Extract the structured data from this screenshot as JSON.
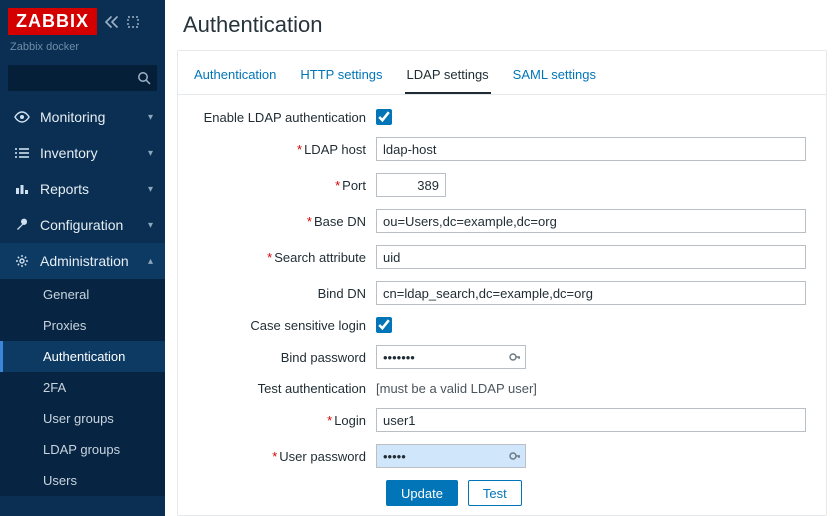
{
  "brand": {
    "logo": "ZABBIX",
    "server_name": "Zabbix docker"
  },
  "search": {
    "placeholder": ""
  },
  "nav": {
    "items": [
      {
        "label": "Monitoring"
      },
      {
        "label": "Inventory"
      },
      {
        "label": "Reports"
      },
      {
        "label": "Configuration"
      },
      {
        "label": "Administration"
      }
    ],
    "admin_sub": [
      {
        "label": "General"
      },
      {
        "label": "Proxies"
      },
      {
        "label": "Authentication"
      },
      {
        "label": "2FA"
      },
      {
        "label": "User groups"
      },
      {
        "label": "LDAP groups"
      },
      {
        "label": "Users"
      }
    ]
  },
  "page": {
    "title": "Authentication"
  },
  "tabs": {
    "items": [
      {
        "label": "Authentication"
      },
      {
        "label": "HTTP settings"
      },
      {
        "label": "LDAP settings"
      },
      {
        "label": "SAML settings"
      }
    ]
  },
  "form": {
    "labels": {
      "enable": "Enable LDAP authentication",
      "host": "LDAP host",
      "port": "Port",
      "basedn": "Base DN",
      "searchattr": "Search attribute",
      "binddn": "Bind DN",
      "casesens": "Case sensitive login",
      "bindpw": "Bind password",
      "testauth": "Test authentication",
      "testauth_hint": "[must be a valid LDAP user]",
      "login": "Login",
      "userpw": "User password"
    },
    "values": {
      "enable": true,
      "host": "ldap-host",
      "port": "389",
      "basedn": "ou=Users,dc=example,dc=org",
      "searchattr": "uid",
      "binddn": "cn=ldap_search,dc=example,dc=org",
      "casesens": true,
      "bindpw": "•••••••",
      "login": "user1",
      "userpw": "•••••"
    },
    "buttons": {
      "update": "Update",
      "test": "Test"
    }
  }
}
